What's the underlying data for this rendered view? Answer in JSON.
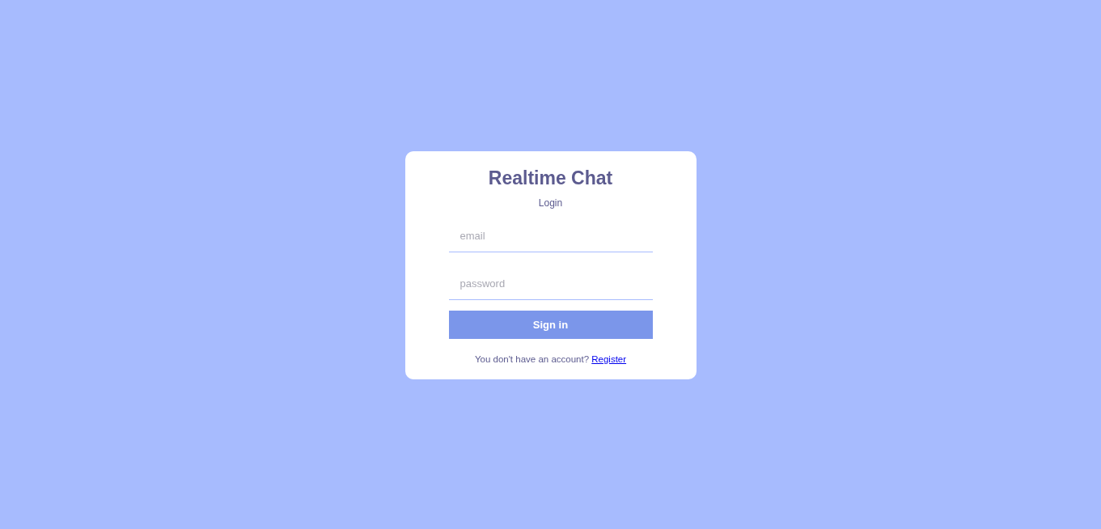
{
  "title": "Realtime Chat",
  "subtitle": "Login",
  "fields": [
    {
      "placeholder": "email"
    },
    {
      "placeholder": "password"
    }
  ],
  "button": {
    "label": "Sign in"
  },
  "footer": {
    "text": "You don't have an account?",
    "link": "Register"
  }
}
